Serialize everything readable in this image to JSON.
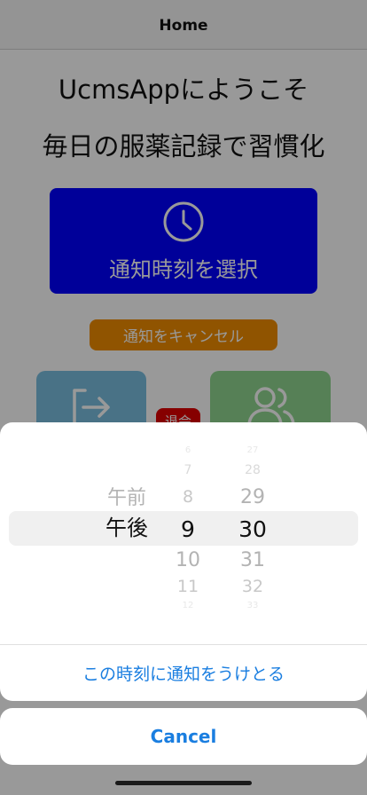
{
  "navbar": {
    "title": "Home"
  },
  "main": {
    "welcome": "UcmsAppにようこそ",
    "tagline": "毎日の服薬記録で習慣化",
    "select_time_label": "通知時刻を選択",
    "cancel_notification_label": "通知をキャンセル",
    "badge_label": "退会"
  },
  "picker": {
    "ampm": {
      "options": [
        "午前",
        "午後"
      ],
      "selected": "午後"
    },
    "hour": {
      "visible": [
        "6",
        "7",
        "8",
        "9",
        "10",
        "11",
        "12"
      ],
      "selected": "9"
    },
    "minute": {
      "visible": [
        "27",
        "28",
        "29",
        "30",
        "31",
        "32",
        "33"
      ],
      "selected": "30"
    }
  },
  "sheet": {
    "confirm_label": "この時刻に通知をうけとる",
    "cancel_label": "Cancel"
  },
  "colors": {
    "primary_button": "#0000ff",
    "cancel_button": "#f08c00",
    "logout_card": "#7bbfe0",
    "users_card": "#8fd68f",
    "badge": "#e00000",
    "action_text": "#1a7ee0"
  },
  "icons": {
    "select_time": "clock-icon",
    "logout": "logout-icon",
    "users": "users-icon"
  }
}
